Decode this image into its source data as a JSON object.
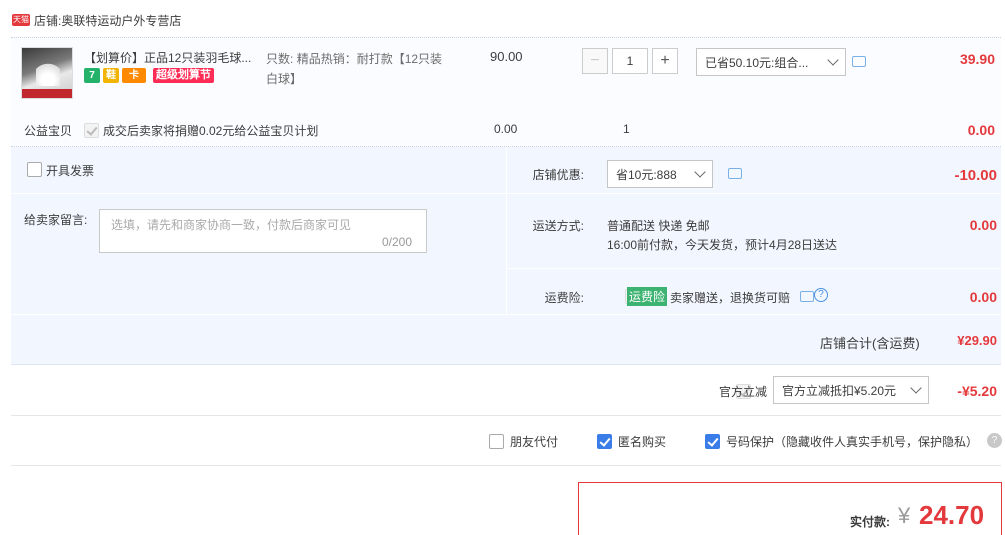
{
  "store": {
    "badge": "天猫",
    "prefix": "店铺:",
    "name": "奥联特运动户外专营店"
  },
  "item": {
    "title": "【划算价】正品12只装羽毛球...",
    "badges": [
      "7",
      "鞋",
      "卡"
    ],
    "promo_tag": "超级划算节",
    "sku_label": "只数:",
    "sku_value": "精品热销：耐打款【12只装白球】",
    "unit_price": "90.00",
    "quantity": "1",
    "minus": "−",
    "plus": "+",
    "bundle_select": "已省50.10元:组合...",
    "subtotal": "39.90"
  },
  "charity": {
    "label": "公益宝贝",
    "text": "成交后卖家将捐赠0.02元给公益宝贝计划",
    "price": "0.00",
    "qty": "1",
    "amount": "0.00"
  },
  "options": {
    "invoice_label": "开具发票",
    "message_label": "给卖家留言:",
    "message_placeholder": "选填，请先和商家协商一致，付款后商家可见",
    "message_count": "0/200",
    "shop_discount_label": "店铺优惠:",
    "shop_discount_select": "省10元:888",
    "shop_discount_amount": "-10.00",
    "shipping_label": "运送方式:",
    "shipping_line1": "普通配送 快递 免邮",
    "shipping_line2": "16:00前付款，今天发货，预计4月28日送达",
    "shipping_amount": "0.00",
    "insurance_label": "运费险:",
    "insurance_tag": "运费险",
    "insurance_text": "卖家赠送，退换货可赔",
    "insurance_amount": "0.00",
    "total_label": "店铺合计(含运费)",
    "total_value": "¥29.90"
  },
  "official": {
    "label": "官方立减",
    "select": "官方立减抵扣¥5.20元",
    "amount": "-¥5.20"
  },
  "checks": {
    "friend_pay": "朋友代付",
    "anonymous": "匿名购买",
    "privacy": "号码保护（隐藏收件人真实手机号，保护隐私）",
    "help": "?"
  },
  "payment": {
    "label": "实付款:",
    "currency": "¥",
    "amount": "24.70"
  },
  "icons": {
    "help": "?"
  },
  "colors": {
    "accent_red": "#e4393c",
    "panel_bg": "#f2f7ff",
    "check_blue": "#3a7de8",
    "insurance_green": "#3cb371"
  }
}
